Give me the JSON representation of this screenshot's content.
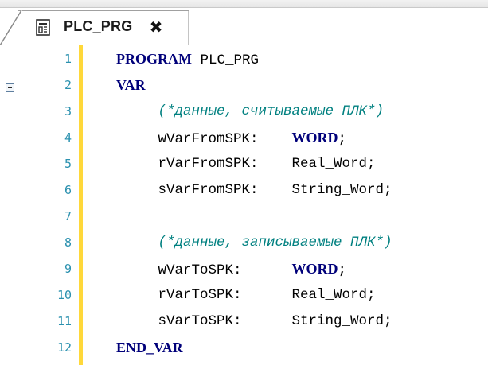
{
  "tab": {
    "title": "PLC_PRG",
    "close_glyph": "✖"
  },
  "icons": {
    "tab_icon": "program-document-icon",
    "fold": "fold-minus-icon"
  },
  "colors": {
    "line_numbers": "#2b91af",
    "change_bar": "#ffd83a",
    "keyword": "#00007a",
    "comment": "#008080"
  },
  "editor": {
    "lines": [
      {
        "num": "1",
        "parts": [
          {
            "t": "PROGRAM",
            "c": "kw"
          },
          {
            "t": " PLC_PRG",
            "c": ""
          }
        ]
      },
      {
        "num": "2",
        "parts": [
          {
            "t": "VAR",
            "c": "kw"
          }
        ]
      },
      {
        "num": "3",
        "parts": [
          {
            "t": "     (*данные, считываемые ПЛК*)",
            "c": "comment"
          }
        ]
      },
      {
        "num": "4",
        "parts": [
          {
            "t": "     wVarFromSPK:    ",
            "c": ""
          },
          {
            "t": "WORD",
            "c": "kw"
          },
          {
            "t": ";",
            "c": ""
          }
        ]
      },
      {
        "num": "5",
        "parts": [
          {
            "t": "     rVarFromSPK:    Real_Word;",
            "c": ""
          }
        ]
      },
      {
        "num": "6",
        "parts": [
          {
            "t": "     sVarFromSPK:    String_Word;",
            "c": ""
          }
        ]
      },
      {
        "num": "7",
        "parts": []
      },
      {
        "num": "8",
        "parts": [
          {
            "t": "     (*данные, записываемые ПЛК*)",
            "c": "comment"
          }
        ]
      },
      {
        "num": "9",
        "parts": [
          {
            "t": "     wVarToSPK:      ",
            "c": ""
          },
          {
            "t": "WORD",
            "c": "kw"
          },
          {
            "t": ";",
            "c": ""
          }
        ]
      },
      {
        "num": "10",
        "parts": [
          {
            "t": "     rVarToSPK:      Real_Word;",
            "c": ""
          }
        ]
      },
      {
        "num": "11",
        "parts": [
          {
            "t": "     sVarToSPK:      String_Word;",
            "c": ""
          }
        ]
      },
      {
        "num": "12",
        "parts": [
          {
            "t": "END_VAR",
            "c": "kw"
          }
        ]
      }
    ]
  }
}
